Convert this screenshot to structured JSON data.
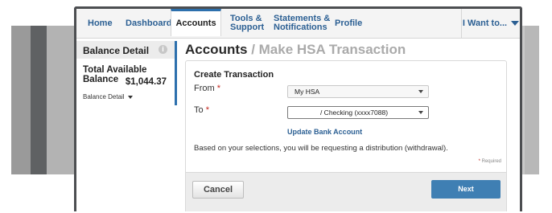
{
  "nav": {
    "items": [
      {
        "label": "Home"
      },
      {
        "label": "Dashboard"
      },
      {
        "label": "Accounts"
      },
      {
        "label1": "Tools &",
        "label2": "Support"
      },
      {
        "label1": "Statements &",
        "label2": "Notifications"
      },
      {
        "label": "Profile"
      }
    ],
    "want": "I Want to..."
  },
  "sidebar": {
    "title": "Balance Detail",
    "info_icon": "i",
    "total_label": "Total Available Balance",
    "total_amount": "$1,044.37",
    "detail_link": "Balance Detail"
  },
  "page": {
    "title": "Accounts",
    "subtitle": " / Make HSA Transaction"
  },
  "form": {
    "section_title": "Create Transaction",
    "from_label": "From ",
    "to_label": "To ",
    "required_mark": "*",
    "from_value": "My HSA",
    "to_value": "/ Checking (xxxx7088)",
    "update_link": "Update Bank Account",
    "note": "Based on your selections, you will be requesting a distribution (withdrawal).",
    "required_text": "Required",
    "cancel": "Cancel",
    "next": "Next"
  }
}
